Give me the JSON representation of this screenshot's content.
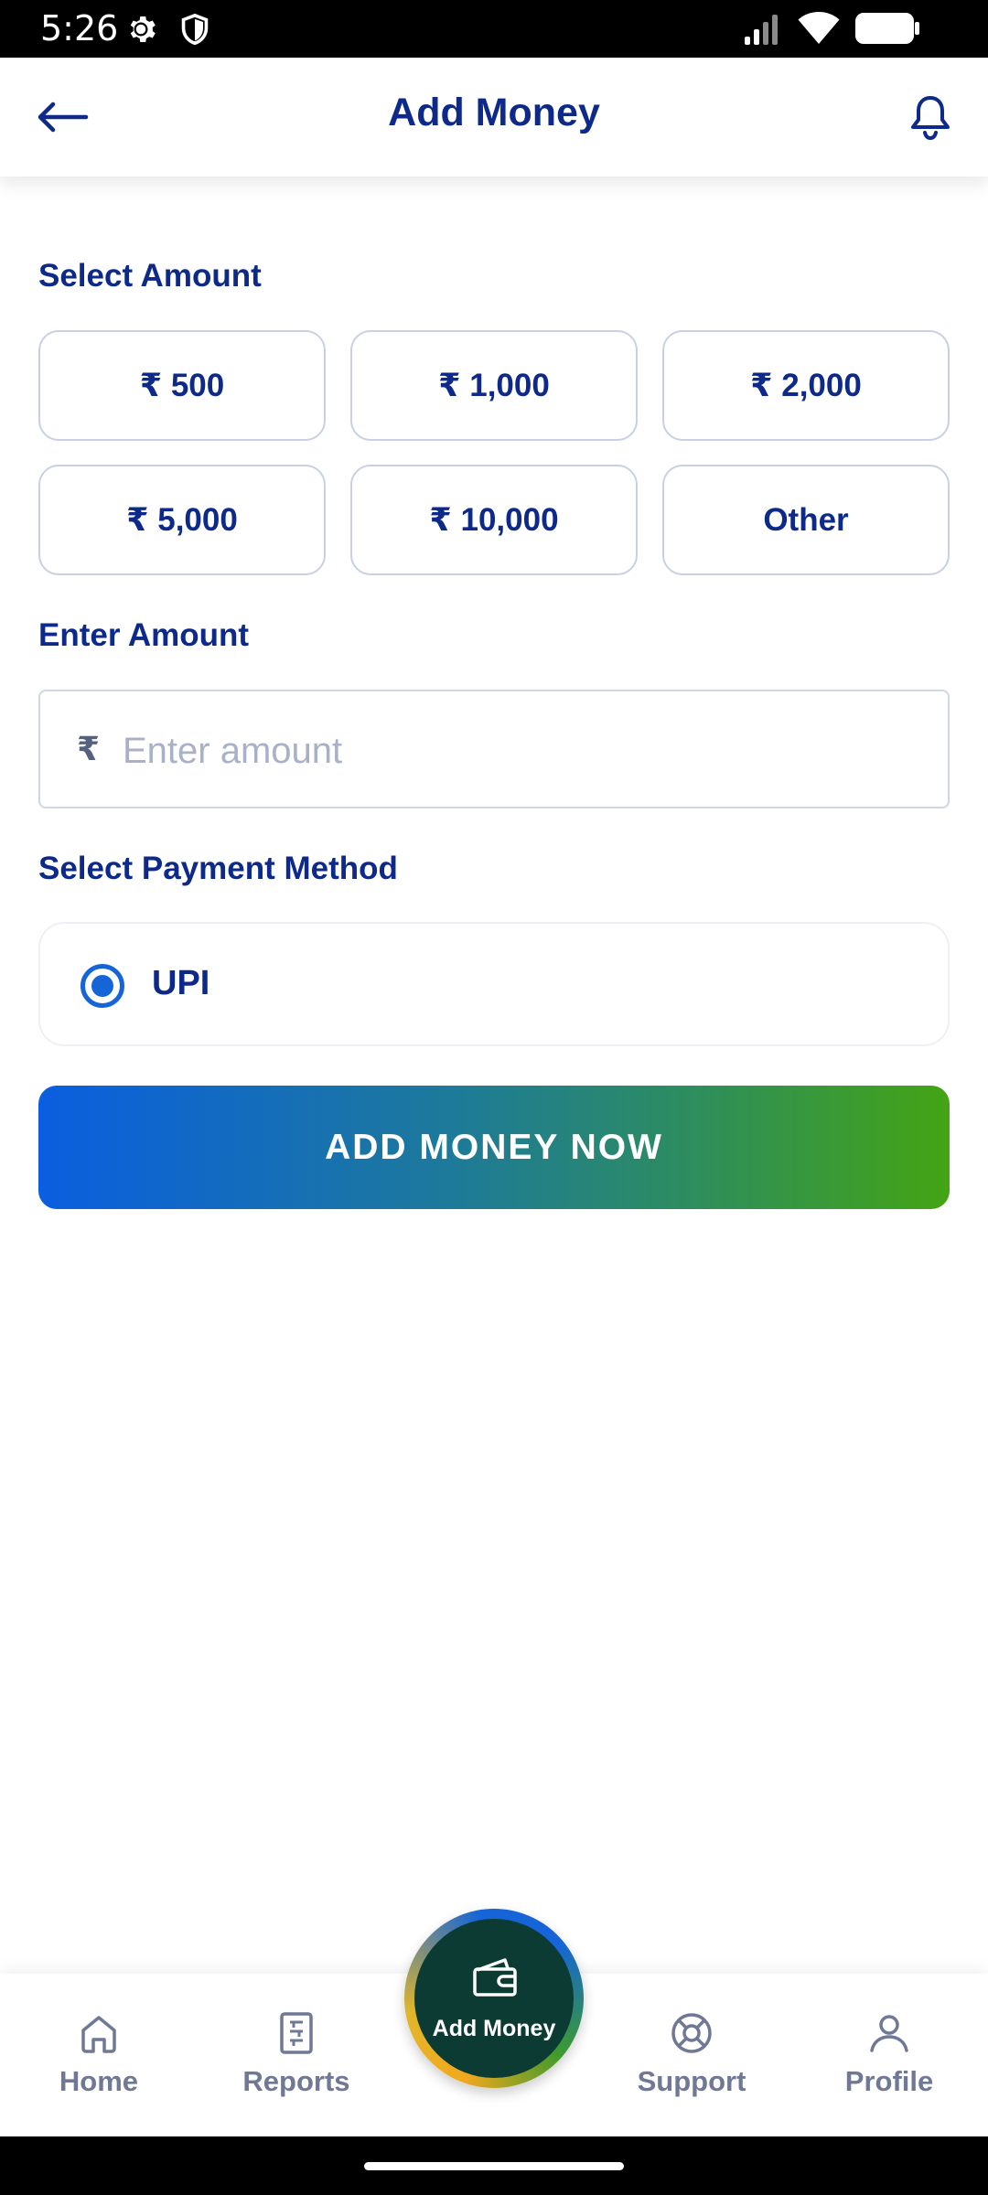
{
  "status_bar": {
    "time": "5:26",
    "icons": [
      "settings-gear-icon",
      "shield-icon",
      "signal-icon",
      "wifi-icon",
      "battery-icon"
    ]
  },
  "header": {
    "title": "Add Money",
    "back_icon": "arrow-left-icon",
    "bell_icon": "bell-icon"
  },
  "select_amount": {
    "label": "Select Amount",
    "options": [
      "₹ 500",
      "₹ 1,000",
      "₹ 2,000",
      "₹ 5,000",
      "₹ 10,000",
      "Other"
    ]
  },
  "enter_amount": {
    "label": "Enter Amount",
    "currency_symbol": "₹",
    "placeholder": "Enter amount",
    "value": ""
  },
  "payment": {
    "label": "Select Payment Method",
    "methods": [
      {
        "label": "UPI",
        "selected": true
      }
    ]
  },
  "cta": {
    "label": "ADD MONEY NOW"
  },
  "bottom_nav": {
    "items": [
      {
        "label": "Home",
        "icon": "home-icon"
      },
      {
        "label": "Reports",
        "icon": "reports-icon"
      },
      {
        "label": "Support",
        "icon": "lifebuoy-icon"
      },
      {
        "label": "Profile",
        "icon": "profile-icon"
      }
    ],
    "fab": {
      "label": "Add Money",
      "icon": "wallet-icon"
    }
  },
  "colors": {
    "primary_text": "#0d2a8a",
    "accent_blue": "#1565d8",
    "accent_green": "#44a414",
    "nav_inactive": "#6f7894"
  }
}
